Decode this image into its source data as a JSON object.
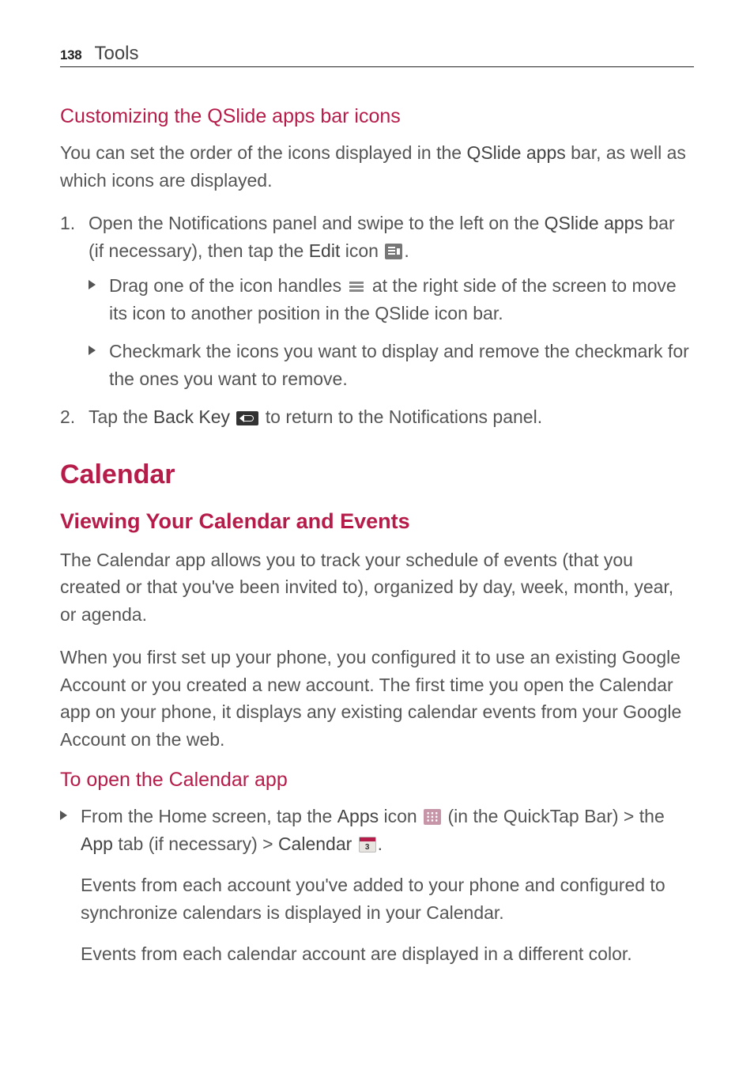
{
  "header": {
    "page_number": "138",
    "section": "Tools"
  },
  "s1": {
    "title": "Customizing the QSlide apps bar icons",
    "intro_a": "You can set the order of the icons displayed in the ",
    "intro_bold": "QSlide apps",
    "intro_b": " bar, as well as which icons are displayed.",
    "step1_a": "Open the Notifications panel and swipe to the left on the ",
    "step1_bold1": "QSlide apps",
    "step1_b": " bar (if necessary), then tap the ",
    "step1_bold2": "Edit",
    "step1_c": " icon ",
    "step1_d": ".",
    "sub1_a": "Drag one of the icon handles ",
    "sub1_b": " at the right side of the screen to move its icon to another position in the QSlide icon bar.",
    "sub2": "Checkmark the icons you want to display and remove the checkmark for the ones you want to remove.",
    "step2_a": "Tap the ",
    "step2_bold": "Back Key",
    "step2_b": " to return to the Notifications panel."
  },
  "s2": {
    "h1": "Calendar",
    "h2": "Viewing Your Calendar and Events",
    "p1": "The Calendar app allows you to track your schedule of events (that you created or that you've been invited to), organized by day, week, month, year, or agenda.",
    "p2": "When you first set up your phone, you configured it to use an existing Google Account or you created a new account. The first time you open the Calendar app on your phone, it displays any existing calendar events from your Google Account on the web.",
    "h3": "To open the Calendar app",
    "b1_a": "From the Home screen, tap the ",
    "b1_bold1": "Apps",
    "b1_b": " icon ",
    "b1_c": " (in the QuickTap Bar) > the ",
    "b1_bold2": "App",
    "b1_d": " tab (if necessary) > ",
    "b1_bold3": "Calendar",
    "b1_e": ".",
    "p3": "Events from each account you've added to your phone and configured to synchronize calendars is displayed in your Calendar.",
    "p4": "Events from each calendar account are displayed in a different color."
  }
}
